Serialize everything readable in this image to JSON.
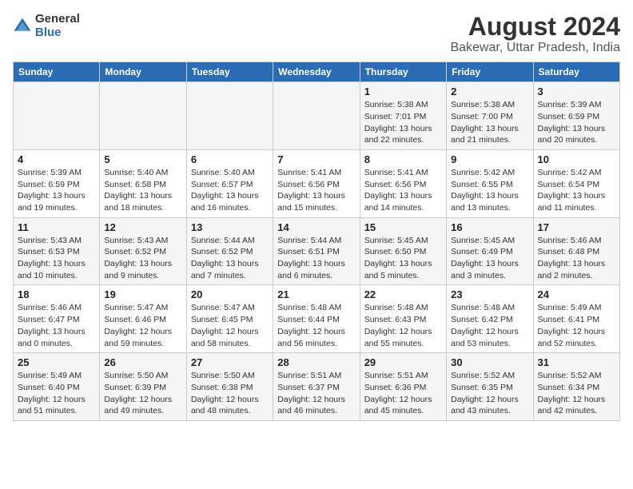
{
  "logo": {
    "general": "General",
    "blue": "Blue"
  },
  "title": "August 2024",
  "subtitle": "Bakewar, Uttar Pradesh, India",
  "headers": [
    "Sunday",
    "Monday",
    "Tuesday",
    "Wednesday",
    "Thursday",
    "Friday",
    "Saturday"
  ],
  "weeks": [
    [
      {
        "day": "",
        "info": ""
      },
      {
        "day": "",
        "info": ""
      },
      {
        "day": "",
        "info": ""
      },
      {
        "day": "",
        "info": ""
      },
      {
        "day": "1",
        "info": "Sunrise: 5:38 AM\nSunset: 7:01 PM\nDaylight: 13 hours and 22 minutes."
      },
      {
        "day": "2",
        "info": "Sunrise: 5:38 AM\nSunset: 7:00 PM\nDaylight: 13 hours and 21 minutes."
      },
      {
        "day": "3",
        "info": "Sunrise: 5:39 AM\nSunset: 6:59 PM\nDaylight: 13 hours and 20 minutes."
      }
    ],
    [
      {
        "day": "4",
        "info": "Sunrise: 5:39 AM\nSunset: 6:59 PM\nDaylight: 13 hours and 19 minutes."
      },
      {
        "day": "5",
        "info": "Sunrise: 5:40 AM\nSunset: 6:58 PM\nDaylight: 13 hours and 18 minutes."
      },
      {
        "day": "6",
        "info": "Sunrise: 5:40 AM\nSunset: 6:57 PM\nDaylight: 13 hours and 16 minutes."
      },
      {
        "day": "7",
        "info": "Sunrise: 5:41 AM\nSunset: 6:56 PM\nDaylight: 13 hours and 15 minutes."
      },
      {
        "day": "8",
        "info": "Sunrise: 5:41 AM\nSunset: 6:56 PM\nDaylight: 13 hours and 14 minutes."
      },
      {
        "day": "9",
        "info": "Sunrise: 5:42 AM\nSunset: 6:55 PM\nDaylight: 13 hours and 13 minutes."
      },
      {
        "day": "10",
        "info": "Sunrise: 5:42 AM\nSunset: 6:54 PM\nDaylight: 13 hours and 11 minutes."
      }
    ],
    [
      {
        "day": "11",
        "info": "Sunrise: 5:43 AM\nSunset: 6:53 PM\nDaylight: 13 hours and 10 minutes."
      },
      {
        "day": "12",
        "info": "Sunrise: 5:43 AM\nSunset: 6:52 PM\nDaylight: 13 hours and 9 minutes."
      },
      {
        "day": "13",
        "info": "Sunrise: 5:44 AM\nSunset: 6:52 PM\nDaylight: 13 hours and 7 minutes."
      },
      {
        "day": "14",
        "info": "Sunrise: 5:44 AM\nSunset: 6:51 PM\nDaylight: 13 hours and 6 minutes."
      },
      {
        "day": "15",
        "info": "Sunrise: 5:45 AM\nSunset: 6:50 PM\nDaylight: 13 hours and 5 minutes."
      },
      {
        "day": "16",
        "info": "Sunrise: 5:45 AM\nSunset: 6:49 PM\nDaylight: 13 hours and 3 minutes."
      },
      {
        "day": "17",
        "info": "Sunrise: 5:46 AM\nSunset: 6:48 PM\nDaylight: 13 hours and 2 minutes."
      }
    ],
    [
      {
        "day": "18",
        "info": "Sunrise: 5:46 AM\nSunset: 6:47 PM\nDaylight: 13 hours and 0 minutes."
      },
      {
        "day": "19",
        "info": "Sunrise: 5:47 AM\nSunset: 6:46 PM\nDaylight: 12 hours and 59 minutes."
      },
      {
        "day": "20",
        "info": "Sunrise: 5:47 AM\nSunset: 6:45 PM\nDaylight: 12 hours and 58 minutes."
      },
      {
        "day": "21",
        "info": "Sunrise: 5:48 AM\nSunset: 6:44 PM\nDaylight: 12 hours and 56 minutes."
      },
      {
        "day": "22",
        "info": "Sunrise: 5:48 AM\nSunset: 6:43 PM\nDaylight: 12 hours and 55 minutes."
      },
      {
        "day": "23",
        "info": "Sunrise: 5:48 AM\nSunset: 6:42 PM\nDaylight: 12 hours and 53 minutes."
      },
      {
        "day": "24",
        "info": "Sunrise: 5:49 AM\nSunset: 6:41 PM\nDaylight: 12 hours and 52 minutes."
      }
    ],
    [
      {
        "day": "25",
        "info": "Sunrise: 5:49 AM\nSunset: 6:40 PM\nDaylight: 12 hours and 51 minutes."
      },
      {
        "day": "26",
        "info": "Sunrise: 5:50 AM\nSunset: 6:39 PM\nDaylight: 12 hours and 49 minutes."
      },
      {
        "day": "27",
        "info": "Sunrise: 5:50 AM\nSunset: 6:38 PM\nDaylight: 12 hours and 48 minutes."
      },
      {
        "day": "28",
        "info": "Sunrise: 5:51 AM\nSunset: 6:37 PM\nDaylight: 12 hours and 46 minutes."
      },
      {
        "day": "29",
        "info": "Sunrise: 5:51 AM\nSunset: 6:36 PM\nDaylight: 12 hours and 45 minutes."
      },
      {
        "day": "30",
        "info": "Sunrise: 5:52 AM\nSunset: 6:35 PM\nDaylight: 12 hours and 43 minutes."
      },
      {
        "day": "31",
        "info": "Sunrise: 5:52 AM\nSunset: 6:34 PM\nDaylight: 12 hours and 42 minutes."
      }
    ]
  ]
}
